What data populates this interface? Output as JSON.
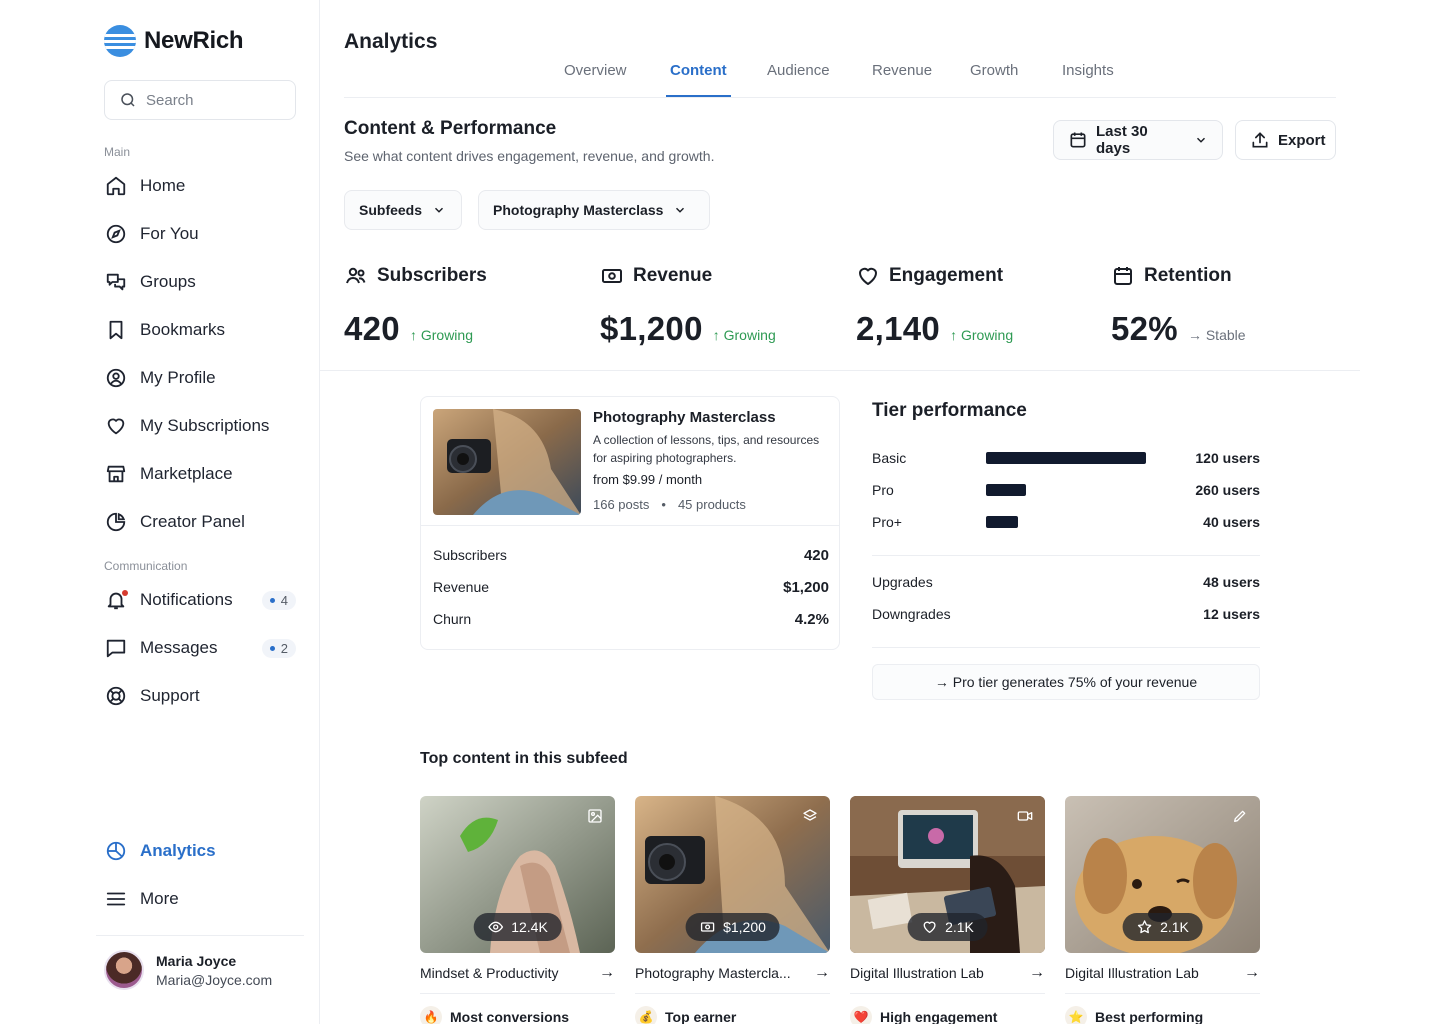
{
  "brand": {
    "name": "NewRich"
  },
  "search": {
    "placeholder": "Search"
  },
  "sidebar": {
    "main_label": "Main",
    "items": [
      {
        "label": "Home",
        "icon": "home-icon"
      },
      {
        "label": "For You",
        "icon": "compass-icon"
      },
      {
        "label": "Groups",
        "icon": "chat-bubbles-icon"
      },
      {
        "label": "Bookmarks",
        "icon": "bookmark-icon"
      },
      {
        "label": "My Profile",
        "icon": "user-circle-icon"
      },
      {
        "label": "My Subscriptions",
        "icon": "heart-icon"
      },
      {
        "label": "Marketplace",
        "icon": "store-icon"
      },
      {
        "label": "Creator Panel",
        "icon": "pie-chart-icon"
      }
    ],
    "communication_label": "Communication",
    "comm_items": [
      {
        "label": "Notifications",
        "icon": "bell-icon",
        "count": "4"
      },
      {
        "label": "Messages",
        "icon": "message-icon",
        "count": "2"
      },
      {
        "label": "Support",
        "icon": "lifebuoy-icon"
      }
    ],
    "bottom_items": [
      {
        "label": "Analytics",
        "icon": "analytics-icon",
        "active": true
      },
      {
        "label": "More",
        "icon": "menu-icon"
      }
    ],
    "user": {
      "name": "Maria Joyce",
      "email": "Maria@Joyce.com"
    }
  },
  "header": {
    "title": "Analytics",
    "tabs": [
      "Overview",
      "Content",
      "Audience",
      "Revenue",
      "Growth",
      "Insights"
    ],
    "active_tab": "Content"
  },
  "section": {
    "title": "Content & Performance",
    "subtitle": "See what content drives engagement, revenue, and growth.",
    "date_range": "Last 30 days",
    "export_label": "Export"
  },
  "filters": {
    "subfeeds": "Subfeeds",
    "selected": "Photography Masterclass"
  },
  "kpis": [
    {
      "label": "Subscribers",
      "value": "420",
      "trend": "↑ Growing",
      "icon": "users-icon"
    },
    {
      "label": "Revenue",
      "value": "$1,200",
      "trend": "↑ Growing",
      "icon": "cash-icon"
    },
    {
      "label": "Engagement",
      "value": "2,140",
      "trend": "↑ Growing",
      "icon": "heart-icon"
    },
    {
      "label": "Retention",
      "value": "52%",
      "trend": "→ Stable",
      "icon": "calendar-icon"
    }
  ],
  "subfeed": {
    "title": "Photography Masterclass",
    "description": "A collection of lessons, tips, and resources for aspiring photographers.",
    "price": "from $9.99 / month",
    "posts": "166 posts",
    "products": "45 products",
    "stats": [
      {
        "label": "Subscribers",
        "value": "420"
      },
      {
        "label": "Revenue",
        "value": "$1,200"
      },
      {
        "label": "Churn",
        "value": "4.2%"
      }
    ]
  },
  "tiers": {
    "title": "Tier performance",
    "rows": [
      {
        "name": "Basic",
        "users": "120 users",
        "fraction": 1.0
      },
      {
        "name": "Pro",
        "users": "260 users",
        "fraction": 0.25
      },
      {
        "name": "Pro+",
        "users": "40 users",
        "fraction": 0.2
      }
    ],
    "changes": [
      {
        "label": "Upgrades",
        "value": "48 users"
      },
      {
        "label": "Downgrades",
        "value": "12 users"
      }
    ],
    "insight": "→ Pro tier generates 75% of your revenue"
  },
  "top_content": {
    "title": "Top content in this subfeed",
    "items": [
      {
        "name": "Mindset & Productivity",
        "metric": "12.4K",
        "metric_icon": "eye-icon",
        "corner_icon": "image-icon",
        "tag": "Most conversions",
        "tag_emoji": "🔥"
      },
      {
        "name": "Photography Mastercla...",
        "metric": "$1,200",
        "metric_icon": "cash-icon",
        "corner_icon": "stack-icon",
        "tag": "Top earner",
        "tag_emoji": "💰"
      },
      {
        "name": "Digital Illustration Lab",
        "metric": "2.1K",
        "metric_icon": "heart-icon",
        "corner_icon": "video-icon",
        "tag": "High engagement",
        "tag_emoji": "❤️"
      },
      {
        "name": "Digital Illustration Lab",
        "metric": "2.1K",
        "metric_icon": "star-icon",
        "corner_icon": "pencil-icon",
        "tag": "Best performing",
        "tag_emoji": "⭐"
      }
    ]
  }
}
